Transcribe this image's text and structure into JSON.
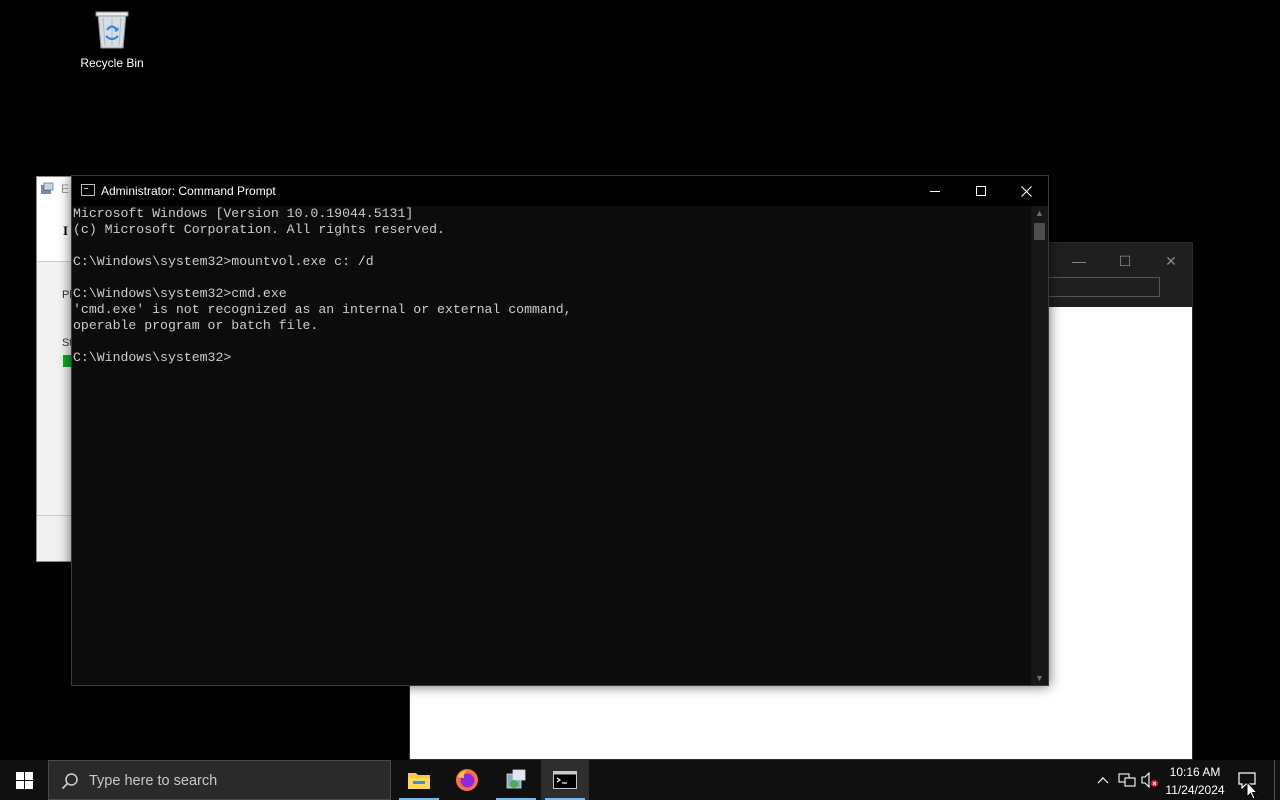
{
  "desktop": {
    "recycle_bin_label": "Recycle Bin"
  },
  "installer_window": {
    "title_fragment": "E",
    "heading_fragment": "I",
    "label_1_fragment": "Pl",
    "label_2_fragment": "St"
  },
  "cmd_window": {
    "title": "Administrator: Command Prompt",
    "lines": [
      "Microsoft Windows [Version 10.0.19044.5131]",
      "(c) Microsoft Corporation. All rights reserved.",
      "",
      "C:\\Windows\\system32>mountvol.exe c: /d",
      "",
      "C:\\Windows\\system32>cmd.exe",
      "'cmd.exe' is not recognized as an internal or external command,",
      "operable program or batch file.",
      "",
      "C:\\Windows\\system32>"
    ]
  },
  "taskbar": {
    "search_placeholder": "Type here to search",
    "apps": [
      "file-explorer",
      "firefox",
      "installer",
      "command-prompt"
    ],
    "active_app": "command-prompt",
    "clock_time": "10:16 AM",
    "clock_date": "11/24/2024"
  },
  "colors": {
    "taskbar_bg": "#101010",
    "console_bg": "#0c0c0c",
    "console_text": "#cccccc",
    "accent": "#76b9ed"
  }
}
